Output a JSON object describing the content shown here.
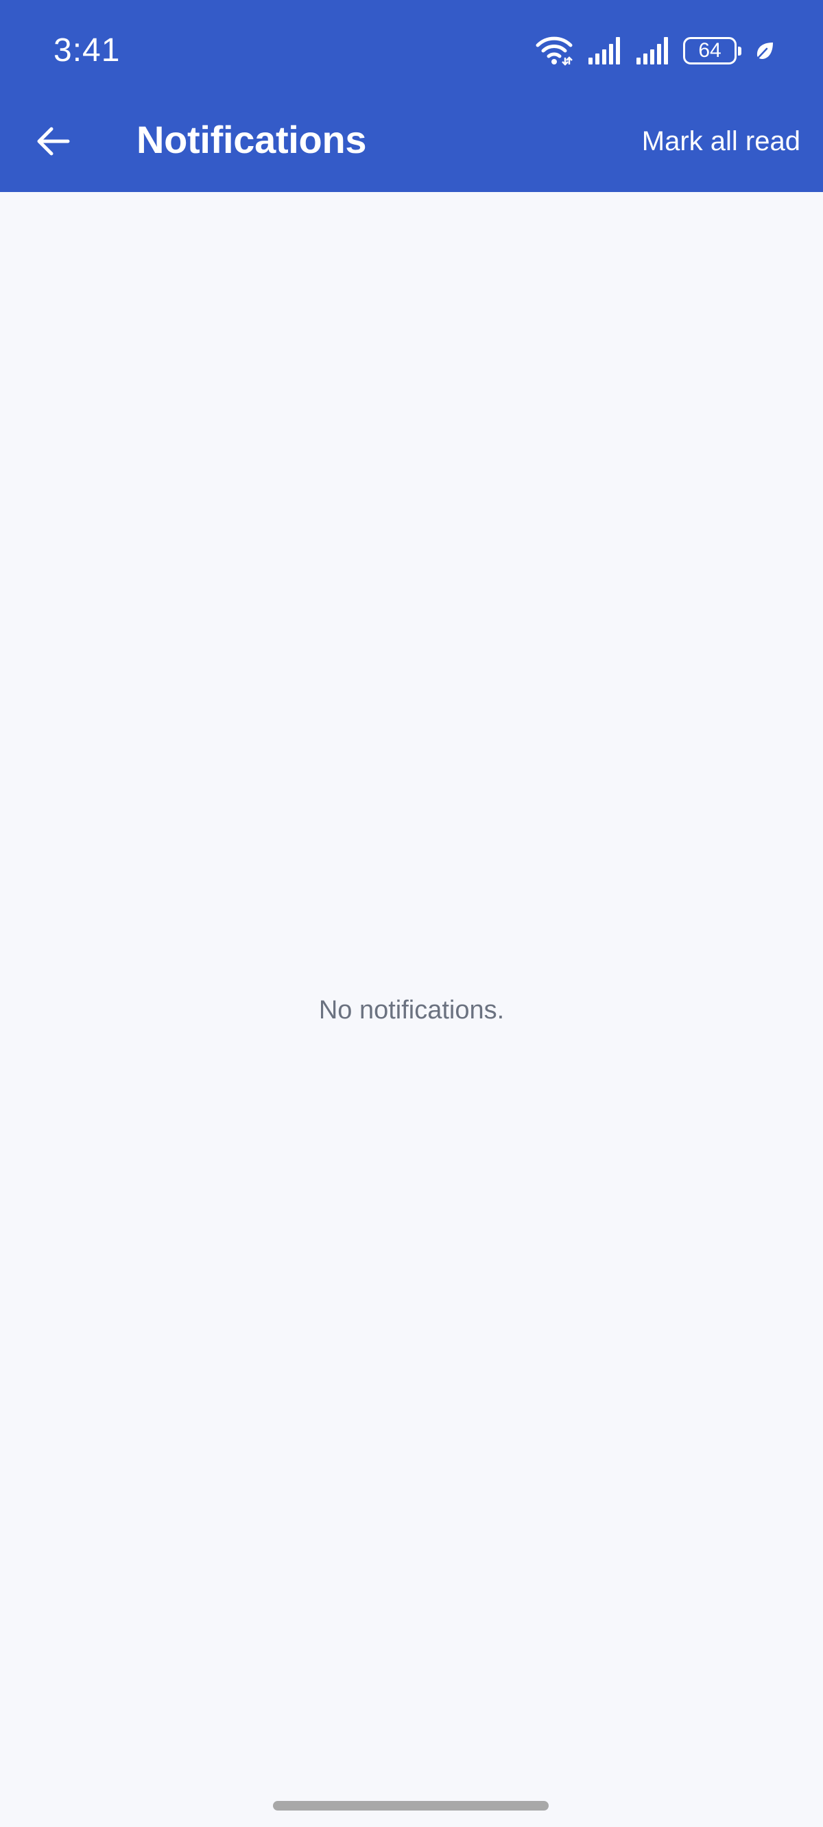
{
  "status_bar": {
    "time": "3:41",
    "battery_level": "64",
    "icons": [
      "wifi-icon",
      "signal-icon",
      "signal-icon",
      "battery-icon",
      "leaf-icon"
    ]
  },
  "app_bar": {
    "title": "Notifications",
    "back_icon": "arrow-left-icon",
    "mark_all_read_label": "Mark all read"
  },
  "content": {
    "empty_message": "No notifications."
  },
  "colors": {
    "header_background": "#345bc8",
    "page_background": "#f7f8fc",
    "empty_text": "#6b7280"
  }
}
